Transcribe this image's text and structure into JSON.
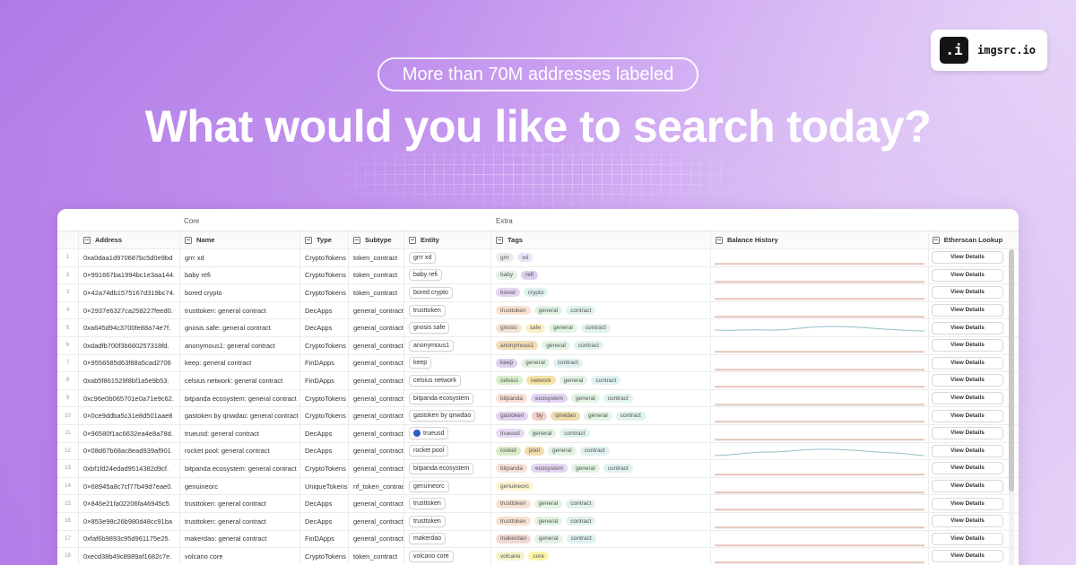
{
  "hero": {
    "pill": "More than 70M addresses labeled",
    "headline": "What would you like to search today?"
  },
  "brand": {
    "mark": ".i",
    "name": "imgsrc.io"
  },
  "table": {
    "groups": {
      "core": "Core",
      "extra": "Extra"
    },
    "columns": {
      "address": "Address",
      "name": "Name",
      "type": "Type",
      "subtype": "Subtype",
      "entity": "Entity",
      "tags": "Tags",
      "balance": "Balance History",
      "etherscan": "Etherscan Lookup"
    },
    "button_label": "View Details",
    "tag_colors": {
      "grrr": "#ececec",
      "xd": "#ece2f7",
      "baby": "#e3f3e6",
      "refi": "#dcd0f0",
      "bored": "#e4d6f3",
      "crypto": "#e0f2f0",
      "trusttoken": "#f6e2d2",
      "general": "#e2f3e4",
      "contract": "#e0f2ef",
      "gnosis": "#f5e3d2",
      "safe": "#fbf0c5",
      "anonymous1": "#f3ddb4",
      "keep": "#ddd0f0",
      "celsius": "#d9eecb",
      "network": "#f4e3a6",
      "bitpanda": "#f8e0d4",
      "ecosystem": "#e2d4f2",
      "gastoken": "#e1d3f0",
      "by": "#f2d0c6",
      "qnwdao": "#efdcae",
      "trueusd": "#e6daf4",
      "rocket": "#d9ecc7",
      "pool": "#f1dcae",
      "genuineorc": "#fbf3cf",
      "makerdao": "#f2d7d2",
      "volcano": "#f5f3c9",
      "core": "#fbf3a6"
    },
    "rows": [
      {
        "n": "1",
        "address": "0xa0daa1d970687bc5d0e9bd",
        "name": "grrr xd",
        "type": "CryptoTokens",
        "subtype": "token_contract",
        "entity": "grrr xd",
        "tags": [
          "grrr",
          "xd"
        ],
        "spark": "flat"
      },
      {
        "n": "2",
        "address": "0×991667ba1994bc1e3aa144.",
        "name": "baby refi",
        "type": "CryptoTokens",
        "subtype": "token_contract",
        "entity": "baby refi",
        "tags": [
          "baby",
          "refi"
        ],
        "spark": "flat"
      },
      {
        "n": "3",
        "address": "0×42a74db1575167d319bc74.",
        "name": "bored crypto",
        "type": "CryptoTokens",
        "subtype": "token_contract",
        "entity": "bored crypto",
        "tags": [
          "bored",
          "crypto"
        ],
        "spark": "flat"
      },
      {
        "n": "4",
        "address": "0×2937e6327ca258227feed0.",
        "name": "trusttoken: general contract",
        "type": "DecApps",
        "subtype": "general_contract",
        "entity": "trusttoken",
        "tags": [
          "trusttoken",
          "general",
          "contract"
        ],
        "spark": "flat"
      },
      {
        "n": "5",
        "address": "0xa645d94c3700fe88a74e7f.",
        "name": "gnosis safe: general contract",
        "type": "DecApps",
        "subtype": "general_contract",
        "entity": "gnosis safe",
        "tags": [
          "gnosis",
          "safe",
          "general",
          "contract"
        ],
        "spark": "wave"
      },
      {
        "n": "6",
        "address": "0xdadfb700f3b660257318fd.",
        "name": "anonymous1: general contract",
        "type": "CryptoTokens",
        "subtype": "general_contract",
        "entity": "anonymous1",
        "tags": [
          "anonymous1",
          "general",
          "contract"
        ],
        "spark": "flat"
      },
      {
        "n": "7",
        "address": "0×9556585d63f88a5cad2706",
        "name": "keep: general contract",
        "type": "FinDApps",
        "subtype": "general_contract",
        "entity": "keep",
        "tags": [
          "keep",
          "general",
          "contract"
        ],
        "spark": "flat"
      },
      {
        "n": "8",
        "address": "0xab5f861529f8bf1a5e9b53.",
        "name": "celsius network: general contract",
        "type": "FinDApps",
        "subtype": "general_contract",
        "entity": "celsius network",
        "tags": [
          "celsius",
          "network",
          "general",
          "contract"
        ],
        "spark": "flat"
      },
      {
        "n": "9",
        "address": "0xc96e0b065701e0a71e9c62.",
        "name": "bitpanda ecosystem: general contract",
        "type": "CryptoTokens",
        "subtype": "general_contract",
        "entity": "bitpanda ecosystem",
        "tags": [
          "bitpanda",
          "ecosystem",
          "general",
          "contract"
        ],
        "spark": "flat"
      },
      {
        "n": "10",
        "address": "0×0ce9ddba5c31e8d501aae8",
        "name": "gastoken by qnwdao: general contract",
        "type": "CryptoTokens",
        "subtype": "general_contract",
        "entity": "gastoken by qnwdao",
        "tags": [
          "gastoken",
          "by",
          "qnwdao",
          "general",
          "contract"
        ],
        "spark": "flat"
      },
      {
        "n": "11",
        "address": "0×96580f1ac6632ea4e8a78d.",
        "name": "trueusd: general contract",
        "type": "DecApps",
        "subtype": "general_contract",
        "entity": "trueusd",
        "entity_logo": true,
        "tags": [
          "trueusd",
          "general",
          "contract"
        ],
        "spark": "flat"
      },
      {
        "n": "12",
        "address": "0×08d67b68ac8ead939af901",
        "name": "rocket pool: general contract",
        "type": "DecApps",
        "subtype": "general_contract",
        "entity": "rocket pool",
        "tags": [
          "rocket",
          "pool",
          "general",
          "contract"
        ],
        "spark": "hill"
      },
      {
        "n": "13",
        "address": "0xbf1fd24edad9514382d9cf.",
        "name": "bitpanda ecosystem: general contract",
        "type": "CryptoTokens",
        "subtype": "general_contract",
        "entity": "bitpanda ecosystem",
        "tags": [
          "bitpanda",
          "ecosystem",
          "general",
          "contract"
        ],
        "spark": "flat"
      },
      {
        "n": "14",
        "address": "0×68945a8c7cf77b49d7eae0.",
        "name": "genuineorc",
        "type": "UniqueTokens",
        "subtype": "nf_token_contract",
        "entity": "genuineorc",
        "tags": [
          "genuineorc"
        ],
        "spark": "flat"
      },
      {
        "n": "15",
        "address": "0×846e21fa02206fa46945c5.",
        "name": "trusttoken: general contract",
        "type": "DecApps",
        "subtype": "general_contract",
        "entity": "trusttoken",
        "tags": [
          "trusttoken",
          "general",
          "contract"
        ],
        "spark": "flat"
      },
      {
        "n": "16",
        "address": "0×853e98c26b980d48cc91ba",
        "name": "trusttoken: general contract",
        "type": "DecApps",
        "subtype": "general_contract",
        "entity": "trusttoken",
        "tags": [
          "trusttoken",
          "general",
          "contract"
        ],
        "spark": "flat"
      },
      {
        "n": "17",
        "address": "0xfaf6b9893c95d961175e25.",
        "name": "makerdao: general contract",
        "type": "FinDApps",
        "subtype": "general_contract",
        "entity": "makerdao",
        "tags": [
          "makerdao",
          "general",
          "contract"
        ],
        "spark": "flat"
      },
      {
        "n": "18",
        "address": "0xecd38b49c8989af1682c7e.",
        "name": "volcano core",
        "type": "CryptoTokens",
        "subtype": "token_contract",
        "entity": "volcano core",
        "tags": [
          "volcano",
          "core"
        ],
        "spark": "flat"
      }
    ]
  }
}
